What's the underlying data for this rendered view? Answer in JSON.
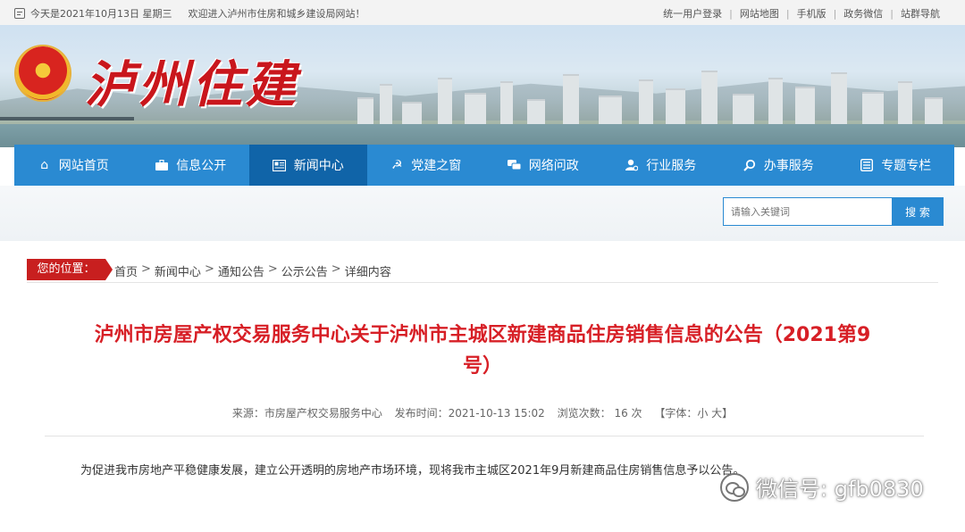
{
  "topbar": {
    "date_text": "今天是2021年10月13日 星期三",
    "welcome_text": "欢迎进入泸州市住房和城乡建设局网站！",
    "links": [
      "统一用户登录",
      "网站地图",
      "手机版",
      "政务微信",
      "站群导航"
    ]
  },
  "header": {
    "logo_text": "泸州住建"
  },
  "nav": {
    "items": [
      {
        "label": "网站首页",
        "icon": "home-icon"
      },
      {
        "label": "信息公开",
        "icon": "briefcase-icon"
      },
      {
        "label": "新闻中心",
        "icon": "newspaper-icon",
        "active": true
      },
      {
        "label": "党建之窗",
        "icon": "hammer-sickle-icon"
      },
      {
        "label": "网络问政",
        "icon": "chat-icon"
      },
      {
        "label": "行业服务",
        "icon": "service-icon"
      },
      {
        "label": "办事服务",
        "icon": "search-icon"
      },
      {
        "label": "专题专栏",
        "icon": "grid-icon"
      }
    ]
  },
  "search": {
    "placeholder": "请输入关键词",
    "button_label": "搜 索"
  },
  "breadcrumb": {
    "label": "您的位置：",
    "items": [
      "首页",
      "新闻中心",
      "通知公告",
      "公示公告",
      "详细内容"
    ],
    "separator": ">"
  },
  "article": {
    "title_line1": "泸州市房屋产权交易服务中心关于泸州市主城区新建商品住房销售信息的公告（2021第9",
    "title_line2": "号）",
    "source": "来源：市房屋产权交易服务中心",
    "publish_time": "发布时间：2021-10-13 15:02",
    "views": "浏览次数： 16 次",
    "font_size": "【字体：小 大】",
    "body": "为促进我市房地产平稳健康发展，建立公开透明的房地产市场环境，现将我市主城区2021年9月新建商品住房销售信息予以公告。"
  },
  "watermark": {
    "text": "微信号: gfb0830"
  },
  "colors": {
    "nav_blue": "#2a8ad2",
    "nav_active": "#1064a8",
    "title_red": "#d71f26",
    "badge_red": "#c81f1f"
  }
}
